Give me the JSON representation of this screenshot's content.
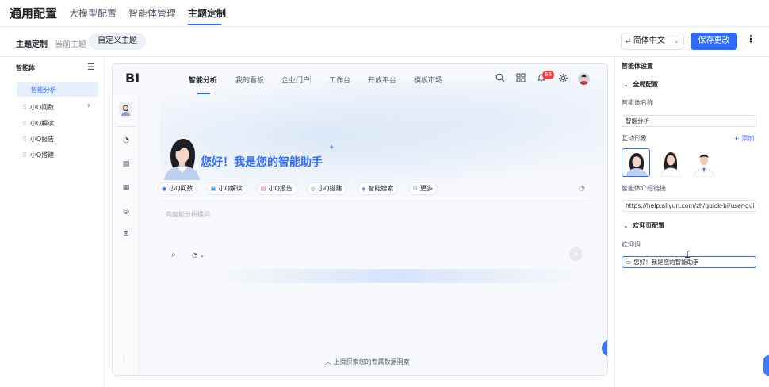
{
  "top": {
    "title": "通用配置",
    "tabs": [
      "大模型配置",
      "智能体管理",
      "主题定制"
    ],
    "active_tab": "主题定制"
  },
  "subbar": {
    "label": "主题定制",
    "current_theme": "当前主题",
    "custom_theme": "自定义主题",
    "language": "简体中文",
    "save": "保存更改",
    "more": "⋮"
  },
  "left": {
    "title": "智能体",
    "items": [
      "智能分析",
      "小Q问数",
      "小Q解读",
      "小Q报告",
      "小Q搭建"
    ]
  },
  "preview": {
    "logo": "BI",
    "nav": [
      "智能分析",
      "我的看板",
      "企业门户",
      "工作台",
      "开放平台",
      "模板市场"
    ],
    "badge": "69",
    "greeting": "您好！我是您的智能助手",
    "chips": [
      "小Q问数",
      "小Q解读",
      "小Q报告",
      "小Q搭建",
      "智能搜索",
      "更多"
    ],
    "input_placeholder": "向智能分析提问",
    "bottom_hint": "上滑探索您的专属数据洞察"
  },
  "right": {
    "title": "智能体设置",
    "global_section": "全局配置",
    "name_label": "智能体名称",
    "name_value": "智能分析",
    "avatar_label": "互动形象",
    "add_label": "+ 添加",
    "link_label": "智能体介绍链接",
    "link_value": "https://help.aliyun.com/zh/quick-bi/user-gui",
    "welcome_section": "欢迎页配置",
    "welcome_label": "欢迎语",
    "welcome_value": "您好！我是您的智能助手"
  },
  "colors": {
    "accent": "#2f6bff",
    "badge": "#f53f3f"
  }
}
